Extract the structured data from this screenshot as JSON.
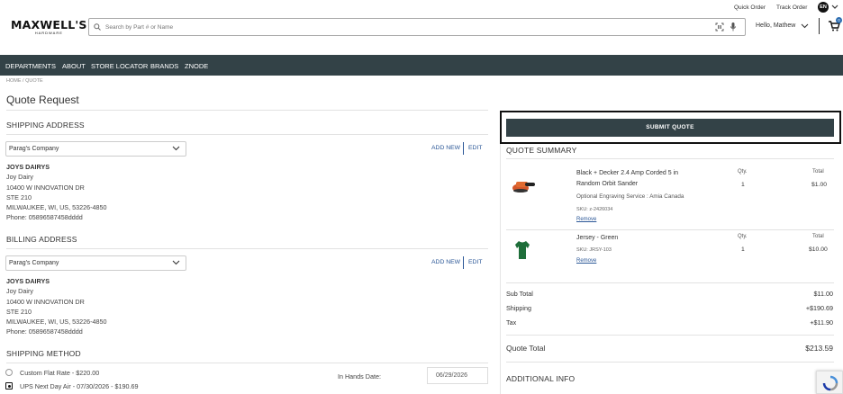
{
  "header": {
    "quick_order": "Quick Order",
    "track_order": "Track Order",
    "language": "EN",
    "logo_main": "MAXWELL'S",
    "logo_sub": "HARDWARE",
    "search_placeholder": "Search by Part # or Name",
    "greeting": "Hello, Mathew",
    "cart_count": "0"
  },
  "nav": {
    "items": [
      "DEPARTMENTS",
      "ABOUT",
      "STORE LOCATOR",
      "BRANDS",
      "ZNODE"
    ]
  },
  "breadcrumb": "HOME / QUOTE",
  "page_title": "Quote Request",
  "shipping_address": {
    "heading": "SHIPPING ADDRESS",
    "selected": "Parag's Company",
    "add_new": "ADD NEW",
    "edit": "EDIT",
    "lines": [
      "JOYS DAIRYS",
      "Joy Dairy",
      "10400 W INNOVATION DR",
      "STE 210",
      "MILWAUKEE, WI, US, 53226-4850",
      "Phone: 05896587458dddd"
    ]
  },
  "billing_address": {
    "heading": "BILLING ADDRESS",
    "selected": "Parag's Company",
    "add_new": "ADD NEW",
    "edit": "EDIT",
    "lines": [
      "JOYS DAIRYS",
      "Joy Dairy",
      "10400 W INNOVATION DR",
      "STE 210",
      "MILWAUKEE, WI, US, 53226-4850",
      "Phone: 05896587458dddd"
    ]
  },
  "shipping_method": {
    "heading": "SHIPPING METHOD",
    "options": [
      "Custom Flat Rate - $220.00",
      "UPS Next Day Air - 07/30/2026 - $190.69"
    ],
    "in_hands_label": "In Hands Date:",
    "in_hands_value": "06/29/2026"
  },
  "summary": {
    "submit_label": "SUBMIT QUOTE",
    "heading": "QUOTE SUMMARY",
    "qty_header": "Qty.",
    "total_header": "Total",
    "items": [
      {
        "name_line1": "Black + Decker 2.4 Amp Corded 5 in",
        "name_line2": "Random Orbit Sander",
        "option": "Optional Engraving Service : Amia Canada",
        "sku": "SKU: z-2426034",
        "remove": "Remove",
        "qty": "1",
        "total": "$1.00"
      },
      {
        "name_line1": "Jersey - Green",
        "sku": "SKU: JRSY-103",
        "remove": "Remove",
        "qty": "1",
        "total": "$10.00"
      }
    ],
    "subtotal_label": "Sub Total",
    "subtotal": "$11.00",
    "shipping_label": "Shipping",
    "shipping": "+$190.69",
    "tax_label": "Tax",
    "tax": "+$11.90",
    "quote_total_label": "Quote Total",
    "quote_total": "$213.59",
    "additional_info": "ADDITIONAL INFO"
  }
}
